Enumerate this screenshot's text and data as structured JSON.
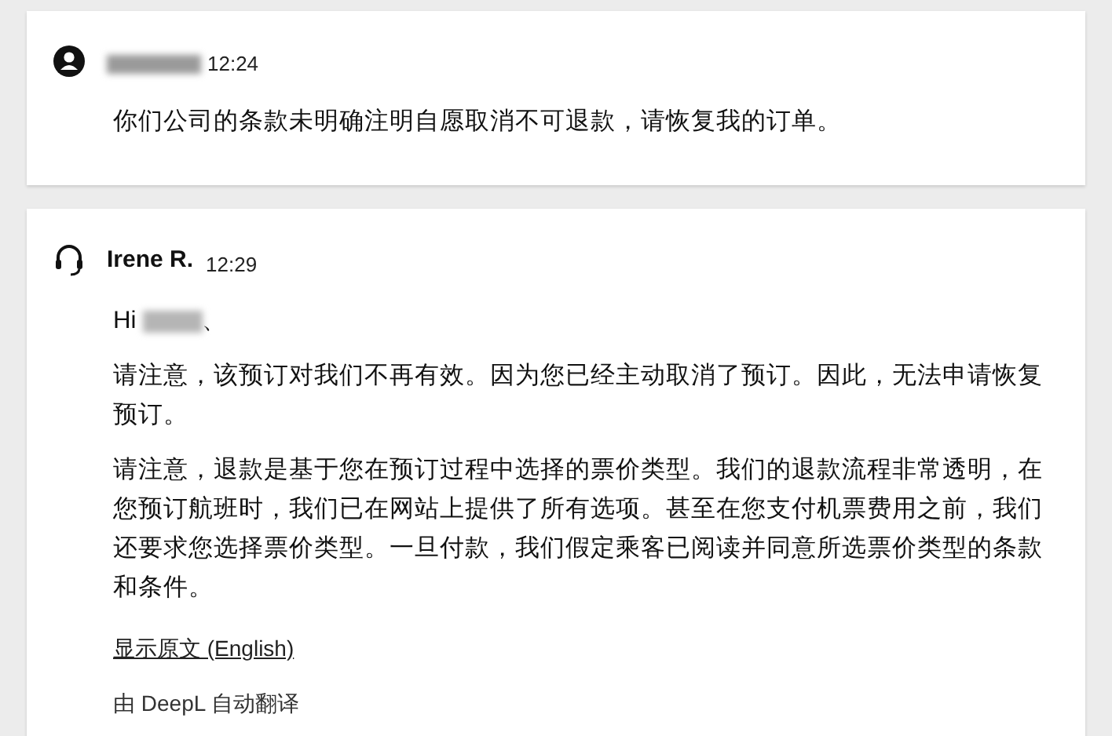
{
  "messages": [
    {
      "kind": "customer",
      "author_redacted": true,
      "time": "12:24",
      "paragraphs": [
        "你们公司的条款未明确注明自愿取消不可退款，请恢复我的订单。"
      ]
    },
    {
      "kind": "agent",
      "author": "Irene R.",
      "time": "12:29",
      "greeting": {
        "prefix": "Hi",
        "suffix": "、"
      },
      "paragraphs": [
        "请注意，该预订对我们不再有效。因为您已经主动取消了预订。因此，无法申请恢复预订。",
        "请注意，退款是基于您在预订过程中选择的票价类型。我们的退款流程非常透明，在您预订航班时，我们已在网站上提供了所有选项。甚至在您支付机票费用之前，我们还要求您选择票价类型。一旦付款，我们假定乘客已阅读并同意所选票价类型的条款和条件。"
      ],
      "show_original_link": "显示原文 (English)",
      "translation_note": "由 DeepL 自动翻译"
    }
  ]
}
